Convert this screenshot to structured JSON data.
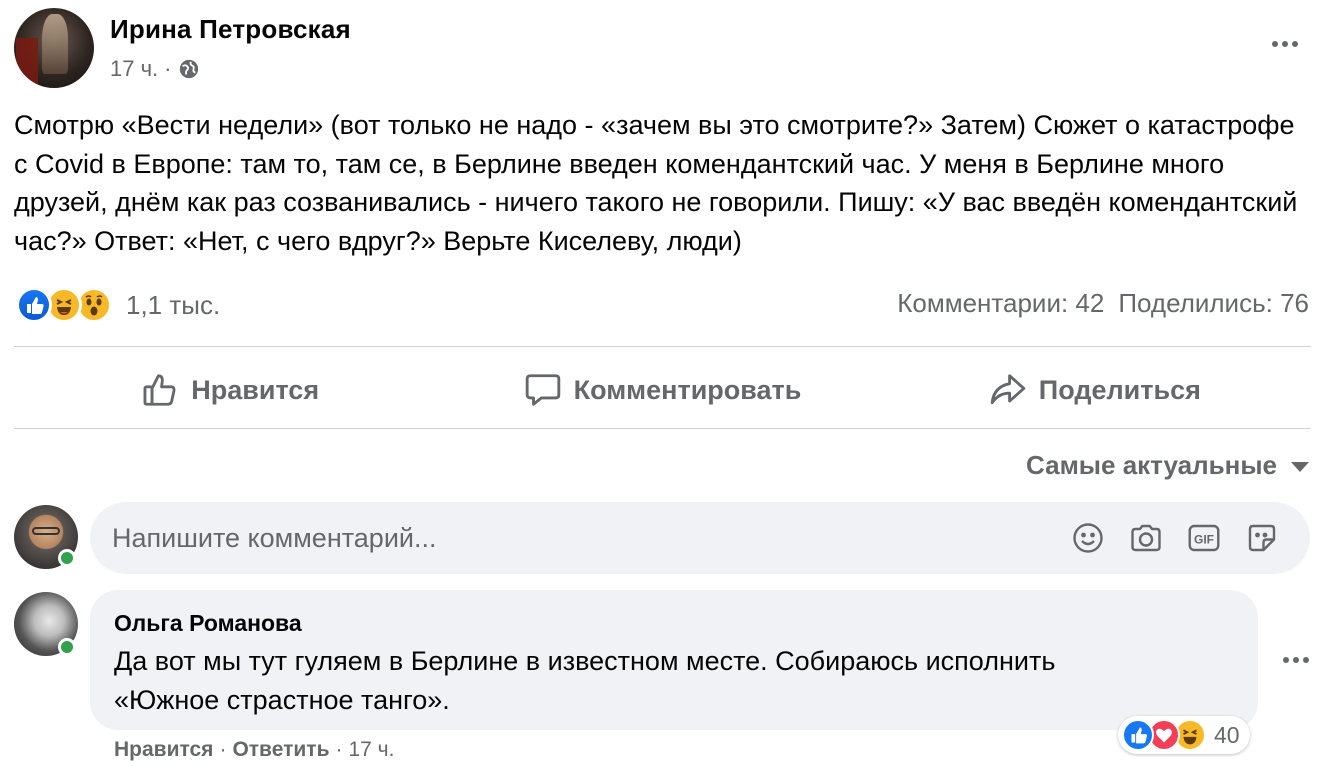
{
  "post": {
    "author": "Ирина Петровская",
    "time": "17 ч.",
    "separator": "·",
    "privacy_icon": "globe-icon",
    "text": "Смотрю «Вести недели» (вот только не надо - «зачем вы это смотрите?» Затем) Сюжет о катастрофе с Covid в Европе: там то, там се, в Берлине введен комендантский час. У меня в Берлине много друзей, днём как раз созванивались - ничего такого не говорили. Пишу: «У вас введён комендантский час?» Ответ: «Нет, с чего вдруг?» Верьте Киселеву, люди)",
    "reactions": {
      "icons": [
        "like-icon",
        "haha-icon",
        "wow-icon"
      ],
      "count": "1,1 тыс."
    },
    "comments_count": "Комментарии: 42",
    "shares_count": "Поделились: 76"
  },
  "actions": {
    "like": "Нравится",
    "comment": "Комментировать",
    "share": "Поделиться"
  },
  "sort": {
    "label": "Самые актуальные"
  },
  "composer": {
    "placeholder": "Напишите комментарий...",
    "icons": [
      "emoji-icon",
      "camera-icon",
      "gif-icon",
      "sticker-icon"
    ]
  },
  "comment": {
    "author": "Ольга Романова",
    "text_line1": "Да вот мы тут гуляем в Берлине в известном месте. Собираюсь исполнить",
    "text_line2": "«Южное страстное танго».",
    "reactions": {
      "icons": [
        "like-icon",
        "love-icon",
        "haha-icon"
      ],
      "count": "40"
    },
    "like_label": "Нравится",
    "reply_label": "Ответить",
    "separator": "·",
    "time": "17 ч."
  },
  "colors": {
    "secondary_text": "#65676b",
    "like_blue": "#1877f2",
    "online_green": "#31a24c",
    "bubble_bg": "#f0f2f5"
  }
}
